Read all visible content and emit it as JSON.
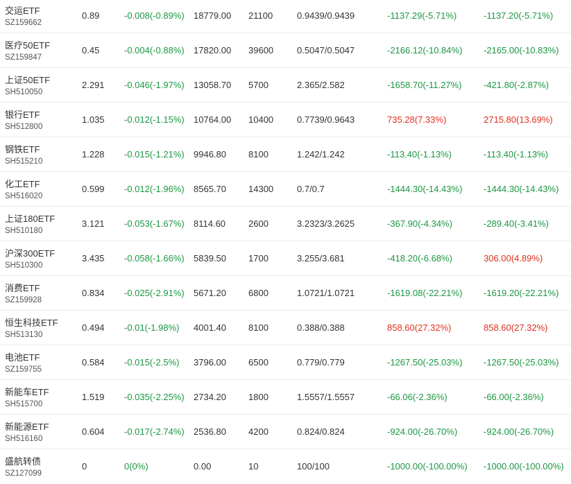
{
  "colors": {
    "up": "#e0301e",
    "down": "#1a9641",
    "text": "#333333"
  },
  "rows": [
    {
      "name": "交运ETF",
      "code": "SZ159662",
      "price": "0.89",
      "change": "-0.008(-0.89%)",
      "market_value": "18779.00",
      "quantity": "21100",
      "cost": "0.9439/0.9439",
      "pl_a": "-1137.29(-5.71%)",
      "pl_b": "-1137.20(-5.71%)",
      "pl_a_dir": "down",
      "pl_b_dir": "down"
    },
    {
      "name": "医疗50ETF",
      "code": "SZ159847",
      "price": "0.45",
      "change": "-0.004(-0.88%)",
      "market_value": "17820.00",
      "quantity": "39600",
      "cost": "0.5047/0.5047",
      "pl_a": "-2166.12(-10.84%)",
      "pl_b": "-2165.00(-10.83%)",
      "pl_a_dir": "down",
      "pl_b_dir": "down"
    },
    {
      "name": "上证50ETF",
      "code": "SH510050",
      "price": "2.291",
      "change": "-0.046(-1.97%)",
      "market_value": "13058.70",
      "quantity": "5700",
      "cost": "2.365/2.582",
      "pl_a": "-1658.70(-11.27%)",
      "pl_b": "-421.80(-2.87%)",
      "pl_a_dir": "down",
      "pl_b_dir": "down"
    },
    {
      "name": "银行ETF",
      "code": "SH512800",
      "price": "1.035",
      "change": "-0.012(-1.15%)",
      "market_value": "10764.00",
      "quantity": "10400",
      "cost": "0.7739/0.9643",
      "pl_a": "735.28(7.33%)",
      "pl_b": "2715.80(13.69%)",
      "pl_a_dir": "up",
      "pl_b_dir": "up"
    },
    {
      "name": "钢铁ETF",
      "code": "SH515210",
      "price": "1.228",
      "change": "-0.015(-1.21%)",
      "market_value": "9946.80",
      "quantity": "8100",
      "cost": "1.242/1.242",
      "pl_a": "-113.40(-1.13%)",
      "pl_b": "-113.40(-1.13%)",
      "pl_a_dir": "down",
      "pl_b_dir": "down"
    },
    {
      "name": "化工ETF",
      "code": "SH516020",
      "price": "0.599",
      "change": "-0.012(-1.96%)",
      "market_value": "8565.70",
      "quantity": "14300",
      "cost": "0.7/0.7",
      "pl_a": "-1444.30(-14.43%)",
      "pl_b": "-1444.30(-14.43%)",
      "pl_a_dir": "down",
      "pl_b_dir": "down"
    },
    {
      "name": "上证180ETF",
      "code": "SH510180",
      "price": "3.121",
      "change": "-0.053(-1.67%)",
      "market_value": "8114.60",
      "quantity": "2600",
      "cost": "3.2323/3.2625",
      "pl_a": "-367.90(-4.34%)",
      "pl_b": "-289.40(-3.41%)",
      "pl_a_dir": "down",
      "pl_b_dir": "down"
    },
    {
      "name": "沪深300ETF",
      "code": "SH510300",
      "price": "3.435",
      "change": "-0.058(-1.66%)",
      "market_value": "5839.50",
      "quantity": "1700",
      "cost": "3.255/3.681",
      "pl_a": "-418.20(-6.68%)",
      "pl_b": "306.00(4.89%)",
      "pl_a_dir": "down",
      "pl_b_dir": "up"
    },
    {
      "name": "消费ETF",
      "code": "SZ159928",
      "price": "0.834",
      "change": "-0.025(-2.91%)",
      "market_value": "5671.20",
      "quantity": "6800",
      "cost": "1.0721/1.0721",
      "pl_a": "-1619.08(-22.21%)",
      "pl_b": "-1619.20(-22.21%)",
      "pl_a_dir": "down",
      "pl_b_dir": "down"
    },
    {
      "name": "恒生科技ETF",
      "code": "SH513130",
      "price": "0.494",
      "change": "-0.01(-1.98%)",
      "market_value": "4001.40",
      "quantity": "8100",
      "cost": "0.388/0.388",
      "pl_a": "858.60(27.32%)",
      "pl_b": "858.60(27.32%)",
      "pl_a_dir": "up",
      "pl_b_dir": "up"
    },
    {
      "name": "电池ETF",
      "code": "SZ159755",
      "price": "0.584",
      "change": "-0.015(-2.5%)",
      "market_value": "3796.00",
      "quantity": "6500",
      "cost": "0.779/0.779",
      "pl_a": "-1267.50(-25.03%)",
      "pl_b": "-1267.50(-25.03%)",
      "pl_a_dir": "down",
      "pl_b_dir": "down"
    },
    {
      "name": "新能车ETF",
      "code": "SH515700",
      "price": "1.519",
      "change": "-0.035(-2.25%)",
      "market_value": "2734.20",
      "quantity": "1800",
      "cost": "1.5557/1.5557",
      "pl_a": "-66.06(-2.36%)",
      "pl_b": "-66.00(-2.36%)",
      "pl_a_dir": "down",
      "pl_b_dir": "down"
    },
    {
      "name": "新能源ETF",
      "code": "SH516160",
      "price": "0.604",
      "change": "-0.017(-2.74%)",
      "market_value": "2536.80",
      "quantity": "4200",
      "cost": "0.824/0.824",
      "pl_a": "-924.00(-26.70%)",
      "pl_b": "-924.00(-26.70%)",
      "pl_a_dir": "down",
      "pl_b_dir": "down"
    },
    {
      "name": "盛航转债",
      "code": "SZ127099",
      "price": "0",
      "change": "0(0%)",
      "market_value": "0.00",
      "quantity": "10",
      "cost": "100/100",
      "pl_a": "-1000.00(-100.00%)",
      "pl_b": "-1000.00(-100.00%)",
      "pl_a_dir": "down",
      "pl_b_dir": "down"
    }
  ]
}
